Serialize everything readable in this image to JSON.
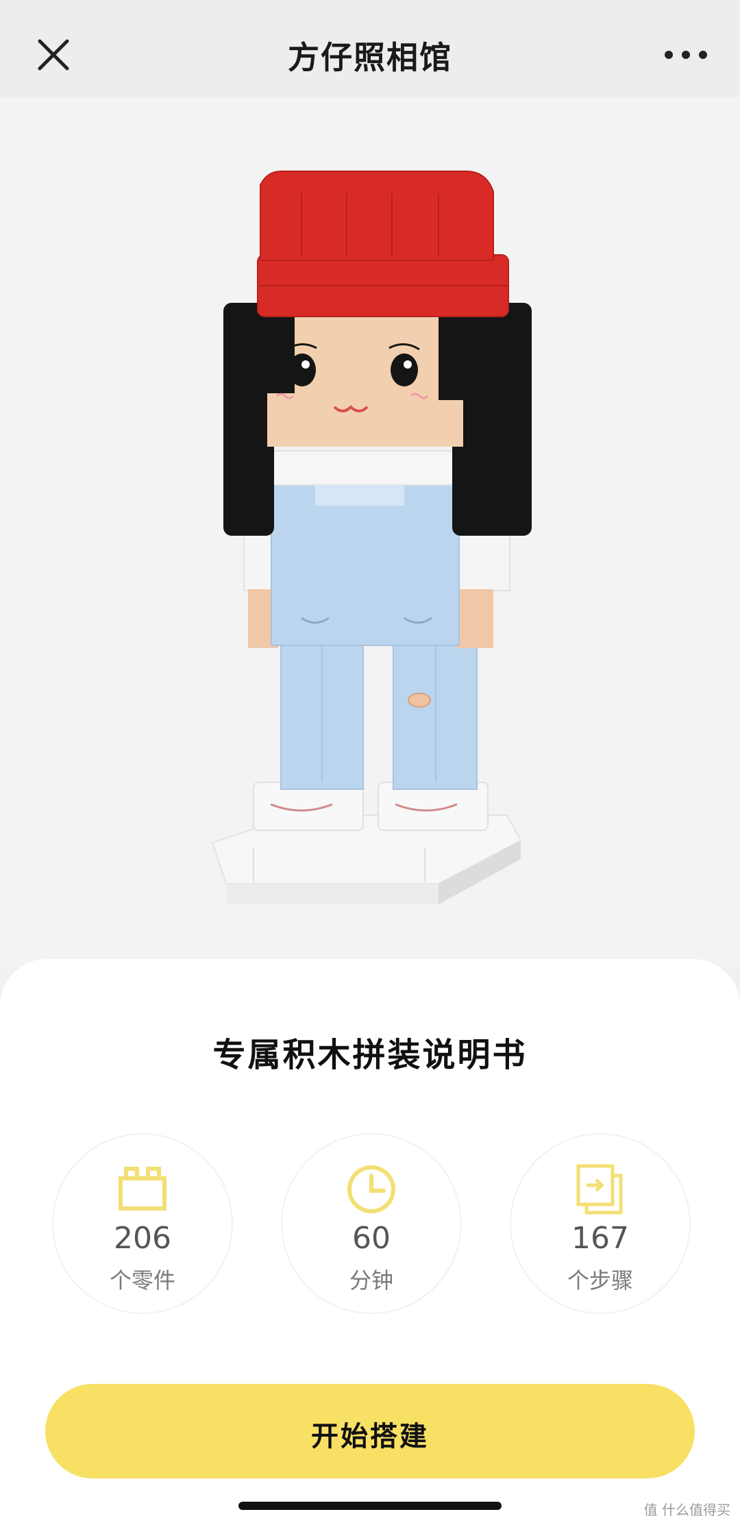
{
  "header": {
    "title": "方仔照相馆",
    "close_icon": "close-icon",
    "more_icon": "more-icon"
  },
  "hero": {
    "image": "brick-figure-illustration",
    "colors": {
      "hat": "#d92b26",
      "hair": "#151515",
      "overalls": "#bcd5ef",
      "base": "#f6f6f6"
    }
  },
  "sheet": {
    "title": "专属积木拼装说明书",
    "stats": [
      {
        "icon": "brick-icon",
        "value": "206",
        "unit": "个零件"
      },
      {
        "icon": "clock-icon",
        "value": "60",
        "unit": "分钟"
      },
      {
        "icon": "steps-icon",
        "value": "167",
        "unit": "个步骤"
      }
    ]
  },
  "cta": {
    "label": "开始搭建"
  },
  "watermark": "值 什么值得买",
  "colors": {
    "accent": "#f8e064",
    "icon": "#f3df73"
  }
}
